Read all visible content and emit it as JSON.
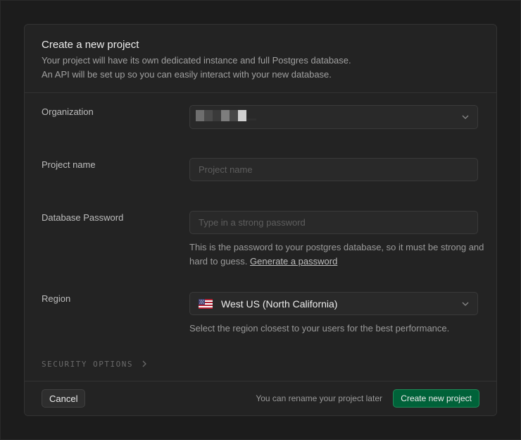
{
  "form": {
    "title": "Create a new project",
    "description_line1": "Your project will have its own dedicated instance and full Postgres database.",
    "description_line2": "An API will be set up so you can easily interact with your new database."
  },
  "organization": {
    "label": "Organization",
    "value_redacted": true,
    "icon": "chevron-down-icon"
  },
  "project_name": {
    "label": "Project name",
    "value": "",
    "placeholder": "Project name"
  },
  "database_password": {
    "label": "Database Password",
    "value": "",
    "placeholder": "Type in a strong password",
    "help_text": "This is the password to your postgres database, so it must be strong and hard to guess.",
    "generate_link": "Generate a password"
  },
  "region": {
    "label": "Region",
    "value": "West US (North California)",
    "flag_icon": "us-flag-icon",
    "help_text": "Select the region closest to your users for the best performance."
  },
  "security_options": {
    "label": "SECURITY OPTIONS",
    "icon": "chevron-right-icon"
  },
  "footer": {
    "cancel_label": "Cancel",
    "note": "You can rename your project later",
    "create_label": "Create new project"
  },
  "colors": {
    "background": "#1c1c1c",
    "panel": "#232323",
    "border": "#333333",
    "input_bg": "#292929",
    "primary_button": "#006239",
    "primary_border": "#1e8a58"
  }
}
